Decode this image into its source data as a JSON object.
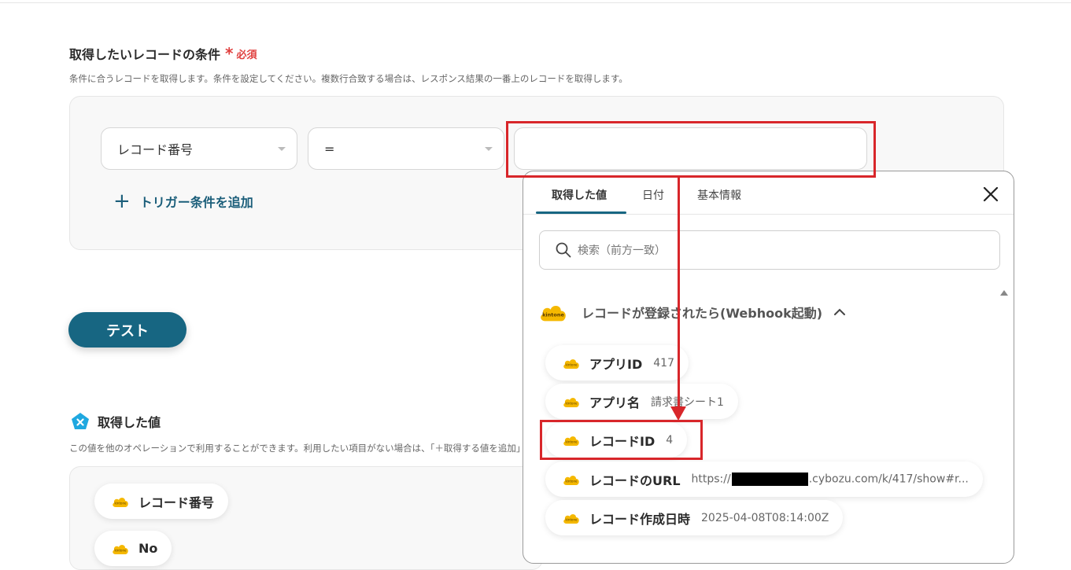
{
  "condition_section": {
    "title": "取得したいレコードの条件",
    "required_mark": "*",
    "required_label": "必須",
    "description": "条件に合うレコードを取得します。条件を設定してください。複数行合致する場合は、レスポンス結果の一番上のレコードを取得します。",
    "field_select": "レコード番号",
    "operator_select": "=",
    "value_input": "",
    "add_trigger_icon": "+",
    "add_trigger_label": "トリガー条件を追加"
  },
  "test_button": "テスト",
  "retrieved_section": {
    "title": "取得した値",
    "description": "この値を他のオペレーションで利用することができます。利用したい項目がない場合は、「＋取得する値を追加」から追加してください。",
    "items": [
      {
        "label": "レコード番号"
      },
      {
        "label": "No"
      }
    ]
  },
  "popup": {
    "tabs": [
      "取得した値",
      "日付",
      "基本情報"
    ],
    "active_tab": 0,
    "search_placeholder": "検索（前方一致）",
    "group_title": "レコードが登録されたら(Webhook起動)",
    "items": [
      {
        "label": "アプリID",
        "value": "417"
      },
      {
        "label": "アプリ名",
        "value": "請求書シート1"
      },
      {
        "label": "レコードID",
        "value": "4"
      },
      {
        "label": "レコードのURL",
        "value_prefix": "https://",
        "value_suffix": ".cybozu.com/k/417/show#r..."
      },
      {
        "label": "レコード作成日時",
        "value": "2025-04-08T08:14:00Z"
      }
    ]
  },
  "icons": {
    "kintone": "kintone-cloud-icon",
    "close": "close-icon",
    "search": "search-icon",
    "chevron": "chevron-up-icon",
    "yoom": "pentagon-x-icon"
  },
  "colors": {
    "accent": "#176682",
    "required": "#e0403f",
    "annotation": "#d8262a",
    "kintone": "#f5b800"
  }
}
